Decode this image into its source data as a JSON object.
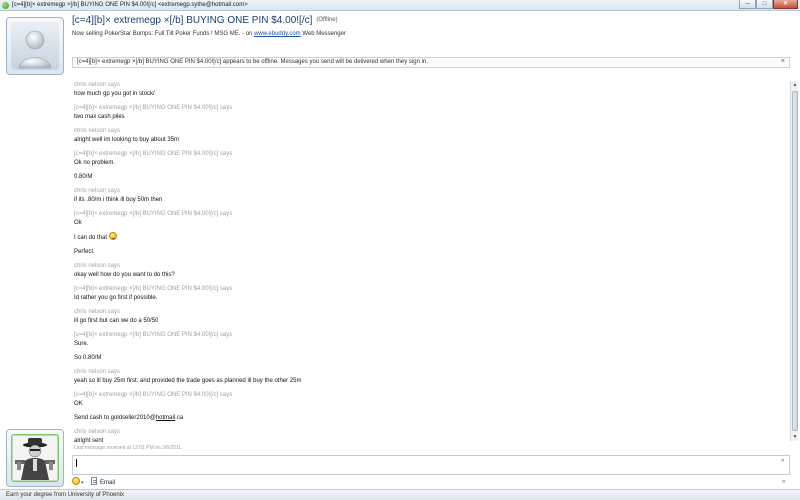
{
  "window": {
    "title": "[c=4][b]× extremegp ×[/b] BUYING ONE PIN $4.00![/c] <extremegp.sythe@hotmail.com>",
    "minimize": "─",
    "maximize": "□",
    "close": "✕"
  },
  "contact": {
    "name": "[c=4][b]× extremegp ×[/b] BUYING ONE PIN $4.00![/c]",
    "status": "(Offline)",
    "personal_message_prefix": "Now selling PokerStar Bumps: Full Tilt Poker Funds ! MSG ME. - on",
    "personal_message_link": "www.ebuddy.com",
    "personal_message_suffix": "Web Messenger"
  },
  "offline_notice": {
    "text": "[c=4][b]× extremegp ×[/b] BUYING ONE PIN $4.00![/c] appears to be offline. Messages you send will be delivered when they sign in.",
    "close": "×"
  },
  "conversation": {
    "me": "chris nelson says",
    "them": "[c=4][b]× extremegp ×[/b] BUYING ONE PIN $4.00![/c] says",
    "m1": "how much gp you got in stock/",
    "m2": "two max cash piles",
    "m3": "alright well im looking to buy about 35m",
    "m4a": "Ok no problem.",
    "m4b": "0.80/M",
    "m5": "if its .80/m i think ill buy 50m then",
    "m6a": "Ok",
    "m6b": "I can do that",
    "m6c": "Perfect.",
    "m7": "okay well how do you want to do this?",
    "m8": "Id rather you go first if possible.",
    "m9": "ill go first but can we do a 50/50",
    "m10a": "Sure.",
    "m10b": "So 0.80/M",
    "m11": "yeah so ill buy 25m first. and provided the trade goes as planned ill buy the other 25m",
    "m12a": "OK",
    "m12b_prefix": "Send cash to goldseller2010@",
    "m12b_link": "hotmail",
    "m12b_suffix": ".ca",
    "m13": "alright sent",
    "last_received": "Last message received at 12:01 PM on 2/6/2011."
  },
  "compose": {
    "value": "",
    "expand": "»"
  },
  "toolbar": {
    "emoticon_chevron": "▾",
    "email_label": "Email",
    "expand": "»"
  },
  "ad": {
    "text": "Earn your degree from University of Phoenix"
  },
  "colors": {
    "accent": "#1b3f73",
    "says_gray": "#9aa3ab",
    "link": "#1a4fa0"
  },
  "icons": [
    "msn-logo-icon",
    "default-user-avatar-icon",
    "gangster-avatar-icon",
    "smiley-icon",
    "email-doc-icon"
  ]
}
